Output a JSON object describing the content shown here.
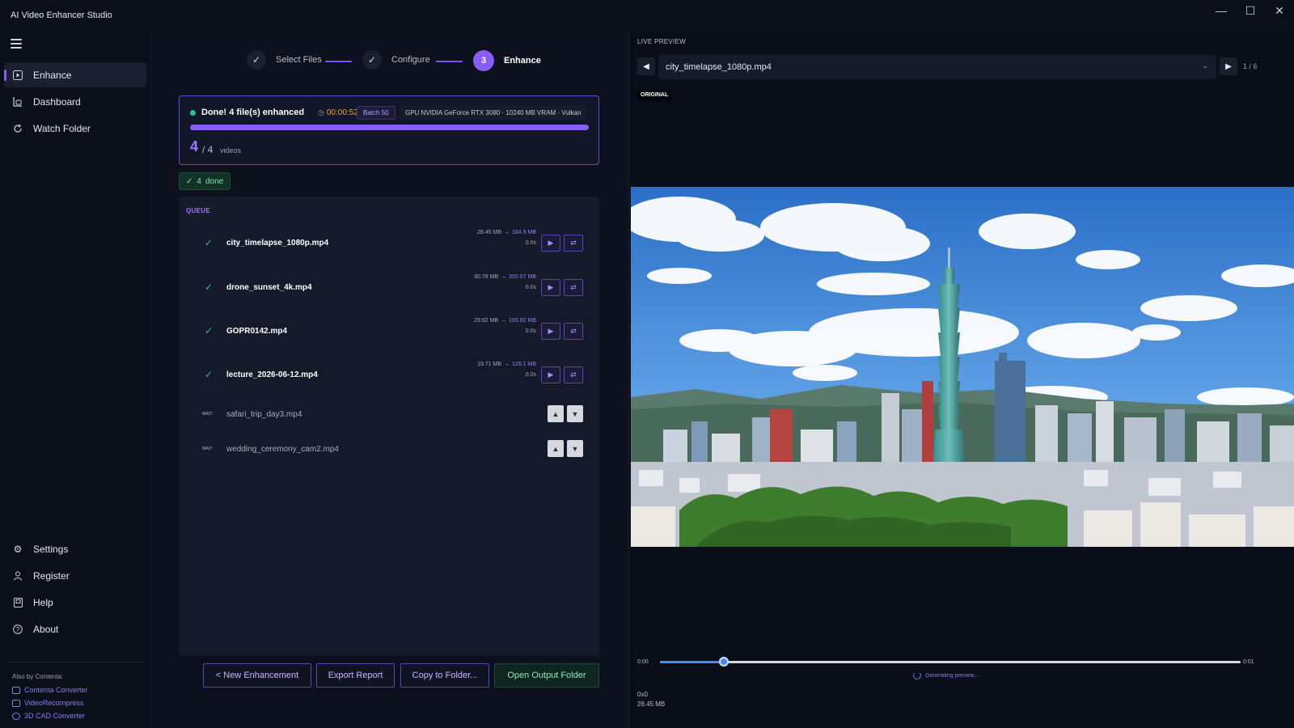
{
  "app": {
    "title": "AI Video Enhancer Studio"
  },
  "window_controls": {
    "minimize": "—",
    "maximize": "☐",
    "close": "✕"
  },
  "sidebar": {
    "items": [
      {
        "label": "Enhance",
        "icon": "play-square-icon",
        "active": true
      },
      {
        "label": "Dashboard",
        "icon": "dashboard-icon"
      },
      {
        "label": "Watch Folder",
        "icon": "refresh-icon"
      }
    ],
    "bottom_items": [
      {
        "label": "Settings",
        "icon": "gear-icon"
      },
      {
        "label": "Register",
        "icon": "user-icon"
      },
      {
        "label": "Help",
        "icon": "help-book-icon"
      },
      {
        "label": "About",
        "icon": "info-circle-icon"
      }
    ],
    "also_by": {
      "title": "Also by Contenta:",
      "links": [
        "Contenta Converter",
        "VideoRecompress",
        "3D CAD Converter"
      ]
    }
  },
  "stepper": {
    "steps": [
      {
        "label": "Select Files",
        "mark": "✓"
      },
      {
        "label": "Configure",
        "mark": "✓"
      },
      {
        "label": "Enhance",
        "mark": "3"
      }
    ]
  },
  "status": {
    "message": "Done! 4 file(s) enhanced s",
    "elapsed": "00:00:52",
    "batch": "Batch 50",
    "gpu": "GPU  NVIDIA GeForce RTX 3080 · 10240 MB VRAM · Vulkan",
    "progress_percent": 100,
    "done_count": "4",
    "total_label": "/ 4",
    "unit": "videos"
  },
  "done_chip": {
    "check": "✓",
    "count": "4",
    "label": "done"
  },
  "queue": {
    "title": "QUEUE",
    "completed": [
      {
        "name": "city_timelapse_1080p.mp4",
        "before": "28.45 MB",
        "after": "184.9 MB",
        "time": "0.0s"
      },
      {
        "name": "drone_sunset_4k.mp4",
        "before": "30.78 MB",
        "after": "200.07 MB",
        "time": "0.0s"
      },
      {
        "name": "GOPR0142.mp4",
        "before": "29.82 MB",
        "after": "193.82 MB",
        "time": "0.0s"
      },
      {
        "name": "lecture_2026-06-12.mp4",
        "before": "19.71 MB",
        "after": "128.1 MB",
        "time": "0.0s"
      }
    ],
    "waiting": [
      {
        "name": "safari_trip_day3.mp4",
        "status": "WAIT"
      },
      {
        "name": "wedding_ceremony_cam2.mp4",
        "status": "WAIT"
      }
    ]
  },
  "footer": {
    "new": "< New Enhancement",
    "export": "Export Report",
    "copy": "Copy to Folder...",
    "open": "Open Output Folder"
  },
  "preview": {
    "label": "LIVE PREVIEW",
    "file": "city_timelapse_1080p.mp4",
    "page": "1 / 6",
    "badge": "ORIGINAL",
    "time_start": "0:00",
    "time_end": "0:01",
    "scrub_fraction": 0.11,
    "generating": "Generating preview...",
    "resolution": "0x0",
    "size": "28.45 MB"
  },
  "colors": {
    "accent": "#8a5cf6",
    "success": "#27c28f",
    "warning": "#e5a83a",
    "link": "#3b8ef0"
  }
}
